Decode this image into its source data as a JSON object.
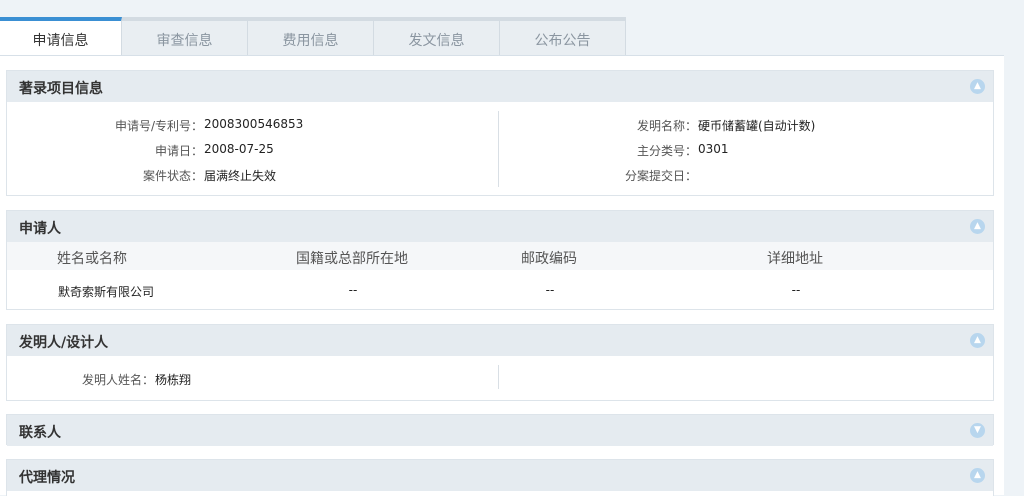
{
  "tabs": [
    {
      "label": "申请信息"
    },
    {
      "label": "审查信息"
    },
    {
      "label": "费用信息"
    },
    {
      "label": "发文信息"
    },
    {
      "label": "公布公告"
    }
  ],
  "bibliographic": {
    "title": "著录项目信息",
    "app_no_label": "申请号/专利号：",
    "app_no": "2008300546853",
    "app_date_label": "申请日：",
    "app_date": "2008-07-25",
    "status_label": "案件状态：",
    "status": "届满终止失效",
    "invention_name_label": "发明名称：",
    "invention_name": "硬币储蓄罐(自动计数)",
    "main_class_label": "主分类号：",
    "main_class": "0301",
    "division_date_label": "分案提交日：",
    "division_date": ""
  },
  "applicant": {
    "title": "申请人",
    "headers": [
      "姓名或名称",
      "国籍或总部所在地",
      "邮政编码",
      "详细地址"
    ],
    "row": [
      "默奇索斯有限公司",
      "--",
      "--",
      "--"
    ]
  },
  "inventor": {
    "title": "发明人/设计人",
    "name_label": "发明人姓名：",
    "name": "杨栋翔"
  },
  "contact": {
    "title": "联系人"
  },
  "agency": {
    "title": "代理情况"
  },
  "icons": {
    "collapse": "chevron-up-icon",
    "expand": "chevron-down-icon"
  }
}
